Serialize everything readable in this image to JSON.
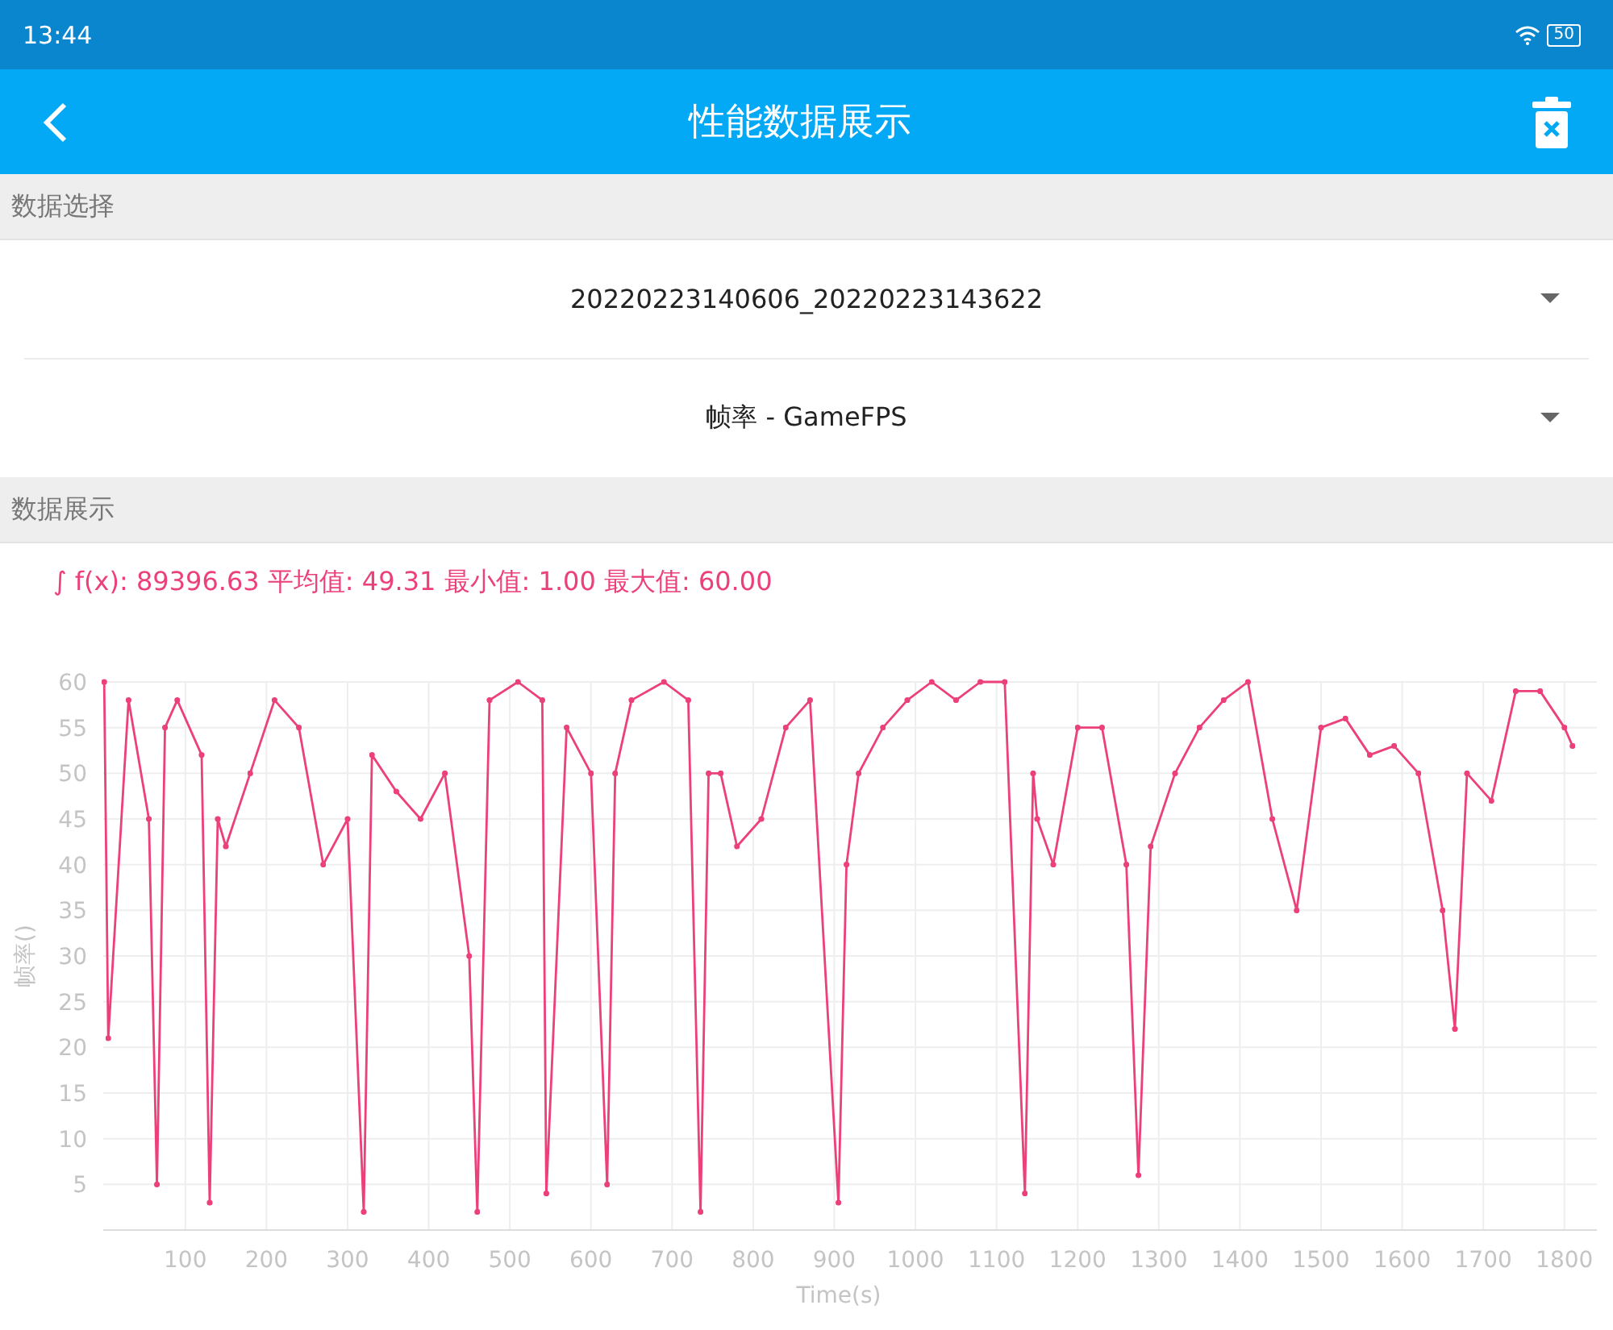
{
  "status_bar": {
    "time": "13:44",
    "battery": "50"
  },
  "header": {
    "title": "性能数据展示"
  },
  "data_select": {
    "label": "数据选择",
    "dropdowns": [
      {
        "value": "20220223140606_20220223143622"
      },
      {
        "value": "帧率 - GameFPS"
      }
    ]
  },
  "data_display": {
    "label": "数据展示",
    "summary": "∫ f(x): 89396.63 平均值: 49.31 最小值: 1.00 最大值: 60.00",
    "chart_data": {
      "type": "line",
      "grid": true,
      "xlabel": "Time(s)",
      "ylabel": "帧率()",
      "xlim": [
        0,
        1840
      ],
      "ylim": [
        0,
        60
      ],
      "xticks": [
        100,
        200,
        300,
        400,
        500,
        600,
        700,
        800,
        900,
        1000,
        1100,
        1200,
        1300,
        1400,
        1500,
        1600,
        1700,
        1800
      ],
      "yticks": [
        5,
        10,
        15,
        20,
        25,
        30,
        35,
        40,
        45,
        50,
        55,
        60
      ],
      "x": [
        0,
        5,
        30,
        55,
        65,
        75,
        90,
        120,
        130,
        140,
        150,
        180,
        210,
        240,
        270,
        300,
        320,
        330,
        360,
        390,
        420,
        450,
        460,
        475,
        510,
        540,
        545,
        570,
        600,
        620,
        630,
        650,
        690,
        720,
        735,
        745,
        760,
        780,
        810,
        840,
        870,
        905,
        915,
        930,
        960,
        990,
        1020,
        1050,
        1080,
        1110,
        1135,
        1145,
        1150,
        1170,
        1200,
        1230,
        1260,
        1275,
        1290,
        1320,
        1350,
        1380,
        1410,
        1440,
        1470,
        1500,
        1530,
        1560,
        1590,
        1620,
        1650,
        1665,
        1680,
        1710,
        1740,
        1770,
        1800,
        1810
      ],
      "values": [
        60,
        21,
        58,
        45,
        5,
        55,
        58,
        52,
        3,
        45,
        42,
        50,
        58,
        55,
        40,
        45,
        2,
        52,
        48,
        45,
        50,
        30,
        2,
        58,
        60,
        58,
        4,
        55,
        50,
        5,
        50,
        58,
        60,
        58,
        2,
        50,
        50,
        42,
        45,
        55,
        58,
        3,
        40,
        50,
        55,
        58,
        60,
        58,
        60,
        60,
        4,
        50,
        45,
        40,
        55,
        55,
        40,
        6,
        42,
        50,
        55,
        58,
        60,
        45,
        35,
        55,
        56,
        52,
        53,
        50,
        35,
        22,
        50,
        47,
        59,
        59,
        55,
        53
      ]
    }
  }
}
